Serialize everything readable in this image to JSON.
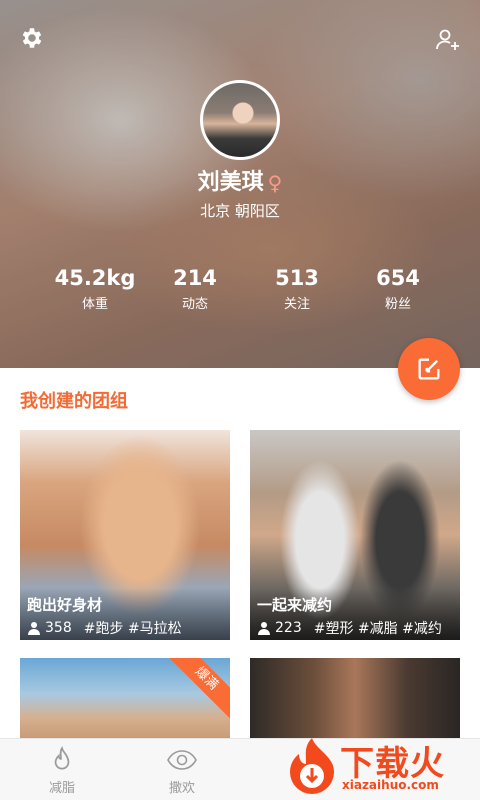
{
  "profile": {
    "name": "刘美琪",
    "gender_symbol": "♀",
    "location": "北京 朝阳区",
    "stats": [
      {
        "value": "45.2kg",
        "label": "体重"
      },
      {
        "value": "214",
        "label": "动态"
      },
      {
        "value": "513",
        "label": "关注"
      },
      {
        "value": "654",
        "label": "粉丝"
      }
    ]
  },
  "section": {
    "title": "我创建的团组"
  },
  "groups": [
    {
      "title": "跑出好身材",
      "members": "358",
      "tags": "#跑步 #马拉松"
    },
    {
      "title": "一起来减约",
      "members": "223",
      "tags": "#塑形 #减脂 #减约"
    },
    {
      "badge": "爆满"
    }
  ],
  "bottom_nav": [
    {
      "label": "减脂",
      "icon": "flame-icon"
    },
    {
      "label": "撒欢",
      "icon": "eye-icon"
    }
  ],
  "watermark": {
    "title": "下载火",
    "url": "xiazaihuo.com"
  },
  "colors": {
    "accent": "#fb6b36",
    "section_title": "#f26a34",
    "gender": "#f79b88"
  }
}
